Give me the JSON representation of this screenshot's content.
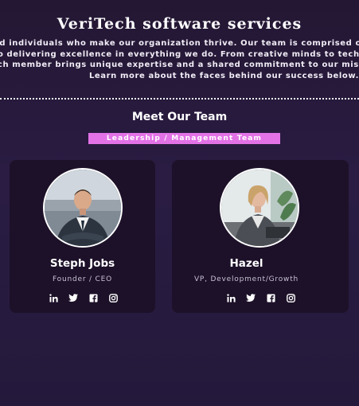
{
  "header": {
    "title": "VeriTech software services",
    "intro_lines": [
      "ed individuals who make our organization thrive. Our team is comprised of",
      "to delivering excellence in everything we do. From creative minds to techn",
      "ach member brings unique expertise and a shared commitment to our missi",
      "Learn more about the faces behind our success below."
    ]
  },
  "team": {
    "section_title": "Meet Our Team",
    "badge": "Leadership / Management Team",
    "members": [
      {
        "name": "Steph Jobs",
        "role": "Founder / CEO",
        "socials": [
          "linkedin-icon",
          "twitter-icon",
          "facebook-icon",
          "instagram-icon"
        ]
      },
      {
        "name": "Hazel",
        "role": "VP, Development/Growth",
        "socials": [
          "linkedin-icon",
          "twitter-icon",
          "facebook-icon",
          "instagram-icon"
        ]
      }
    ]
  },
  "colors": {
    "background": "#2a1c43",
    "card": "#1d1129",
    "badge": "#e272e6",
    "text": "#ffffff",
    "muted": "#c8c0d4"
  }
}
